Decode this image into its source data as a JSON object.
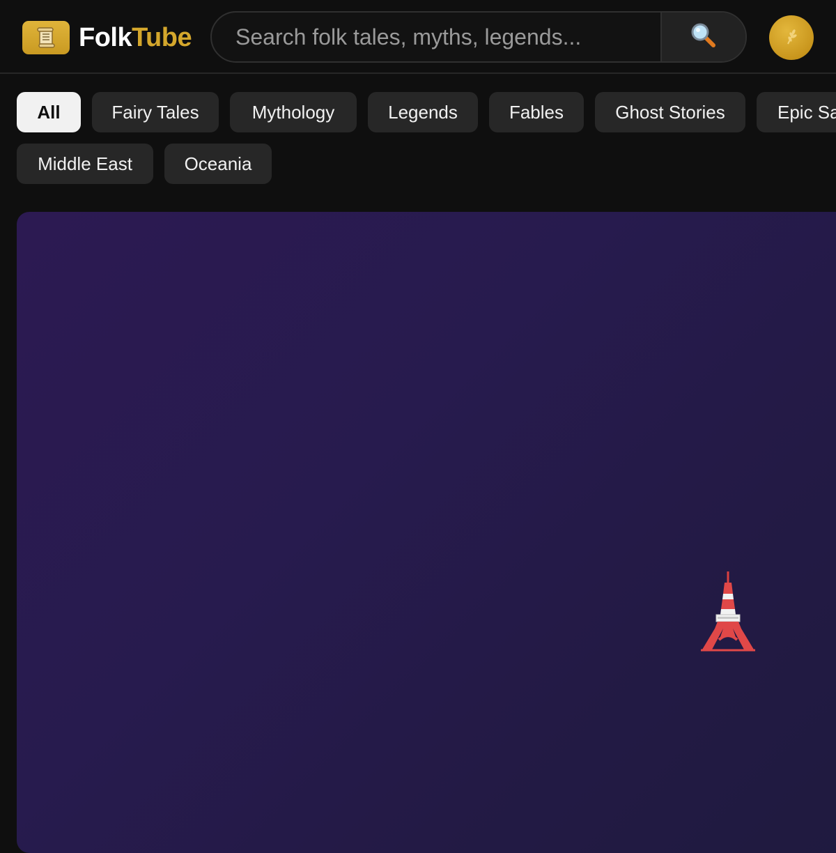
{
  "app": {
    "name_part1": "Folk",
    "name_part2": "Tube",
    "logo_icon": "scroll-icon",
    "brand_color": "#d4a72c"
  },
  "search": {
    "placeholder": "Search folk tales, myths, legends...",
    "value": "",
    "button_icon": "magnifier-icon"
  },
  "avatar": {
    "icon": "wheat-icon"
  },
  "categories": [
    {
      "label": "All",
      "active": true
    },
    {
      "label": "Fairy Tales",
      "active": false
    },
    {
      "label": "Mythology",
      "active": false
    },
    {
      "label": "Legends",
      "active": false
    },
    {
      "label": "Fables",
      "active": false
    },
    {
      "label": "Ghost Stories",
      "active": false
    },
    {
      "label": "Epic Sa",
      "active": false
    },
    {
      "label": "Middle East",
      "active": false
    },
    {
      "label": "Oceania",
      "active": false
    }
  ],
  "hero": {
    "icon": "tokyo-tower-icon",
    "background_colors": [
      "#2c1a52",
      "#1f1a3f"
    ]
  }
}
